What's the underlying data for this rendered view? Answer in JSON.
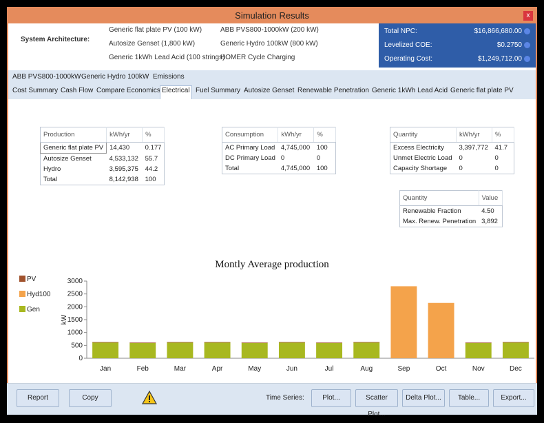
{
  "window": {
    "title": "Simulation Results",
    "close_label": "x"
  },
  "architecture": {
    "label": "System Architecture:",
    "col1": [
      "Generic flat plate PV (100 kW)",
      "Autosize Genset (1,800 kW)",
      "Generic 1kWh Lead Acid (100 strings)"
    ],
    "col2": [
      "ABB PVS800-1000kW (200 kW)",
      "Generic Hydro 100kW (800 kW)",
      "HOMER Cycle Charging"
    ]
  },
  "summary": [
    {
      "label": "Total NPC:",
      "value": "$16,866,680.00"
    },
    {
      "label": "Levelized COE:",
      "value": "$0.2750"
    },
    {
      "label": "Operating Cost:",
      "value": "$1,249,712.00"
    }
  ],
  "tabs_row1": [
    "ABB PVS800-1000kW",
    "Generic Hydro 100kW",
    "Emissions"
  ],
  "tabs_row2": [
    "Cost Summary",
    "Cash Flow",
    "Compare Economics",
    "Electrical",
    "Fuel Summary",
    "Autosize Genset",
    "Renewable Penetration",
    "Generic 1kWh Lead Acid",
    "Generic flat plate PV"
  ],
  "production_table": {
    "headers": [
      "Production",
      "kWh/yr",
      "%"
    ],
    "rows": [
      [
        "Generic flat plate PV",
        "14,430",
        "0.177"
      ],
      [
        "Autosize Genset",
        "4,533,132",
        "55.7"
      ],
      [
        "Hydro",
        "3,595,375",
        "44.2"
      ],
      [
        "Total",
        "8,142,938",
        "100"
      ]
    ]
  },
  "consumption_table": {
    "headers": [
      "Consumption",
      "kWh/yr",
      "%"
    ],
    "rows": [
      [
        "AC Primary Load",
        "4,745,000",
        "100"
      ],
      [
        "DC Primary Load",
        "0",
        "0"
      ],
      [
        "Total",
        "4,745,000",
        "100"
      ]
    ]
  },
  "quantity_table": {
    "headers": [
      "Quantity",
      "kWh/yr",
      "%"
    ],
    "rows": [
      [
        "Excess Electricity",
        "3,397,772",
        "41.7"
      ],
      [
        "Unmet Electric Load",
        "0",
        "0"
      ],
      [
        "Capacity Shortage",
        "0",
        "0"
      ]
    ]
  },
  "renewable_table": {
    "headers": [
      "Quantity",
      "Value"
    ],
    "rows": [
      [
        "Renewable Fraction",
        "4.50"
      ],
      [
        "Max. Renew. Penetration",
        "3,892"
      ]
    ]
  },
  "chart_data": {
    "type": "bar",
    "title": "Montly Average production",
    "ylabel": "kW",
    "xlabel": "",
    "ylim": [
      0,
      3000
    ],
    "yticks": [
      0,
      500,
      1000,
      1500,
      2000,
      2500,
      3000
    ],
    "categories": [
      "Jan",
      "Feb",
      "Mar",
      "Apr",
      "May",
      "Jun",
      "Jul",
      "Aug",
      "Sep",
      "Oct",
      "Nov",
      "Dec"
    ],
    "series": [
      {
        "name": "PV",
        "color": "#a0522d",
        "values": [
          10,
          10,
          10,
          10,
          10,
          10,
          10,
          10,
          0,
          0,
          10,
          10
        ]
      },
      {
        "name": "Hyd100",
        "color": "#f4a34b",
        "values": [
          0,
          0,
          0,
          0,
          0,
          0,
          0,
          0,
          2800,
          2150,
          0,
          0
        ]
      },
      {
        "name": "Gen",
        "color": "#a8b820",
        "values": [
          620,
          600,
          620,
          620,
          600,
          620,
          600,
          620,
          0,
          0,
          600,
          620
        ]
      }
    ],
    "legend_position": "top-left",
    "grid": false
  },
  "footer": {
    "report": "Report",
    "copy": "Copy",
    "time_series": "Time Series:",
    "plot": "Plot...",
    "scatter": "Scatter Plot...",
    "delta": "Delta Plot...",
    "table": "Table...",
    "export": "Export..."
  }
}
